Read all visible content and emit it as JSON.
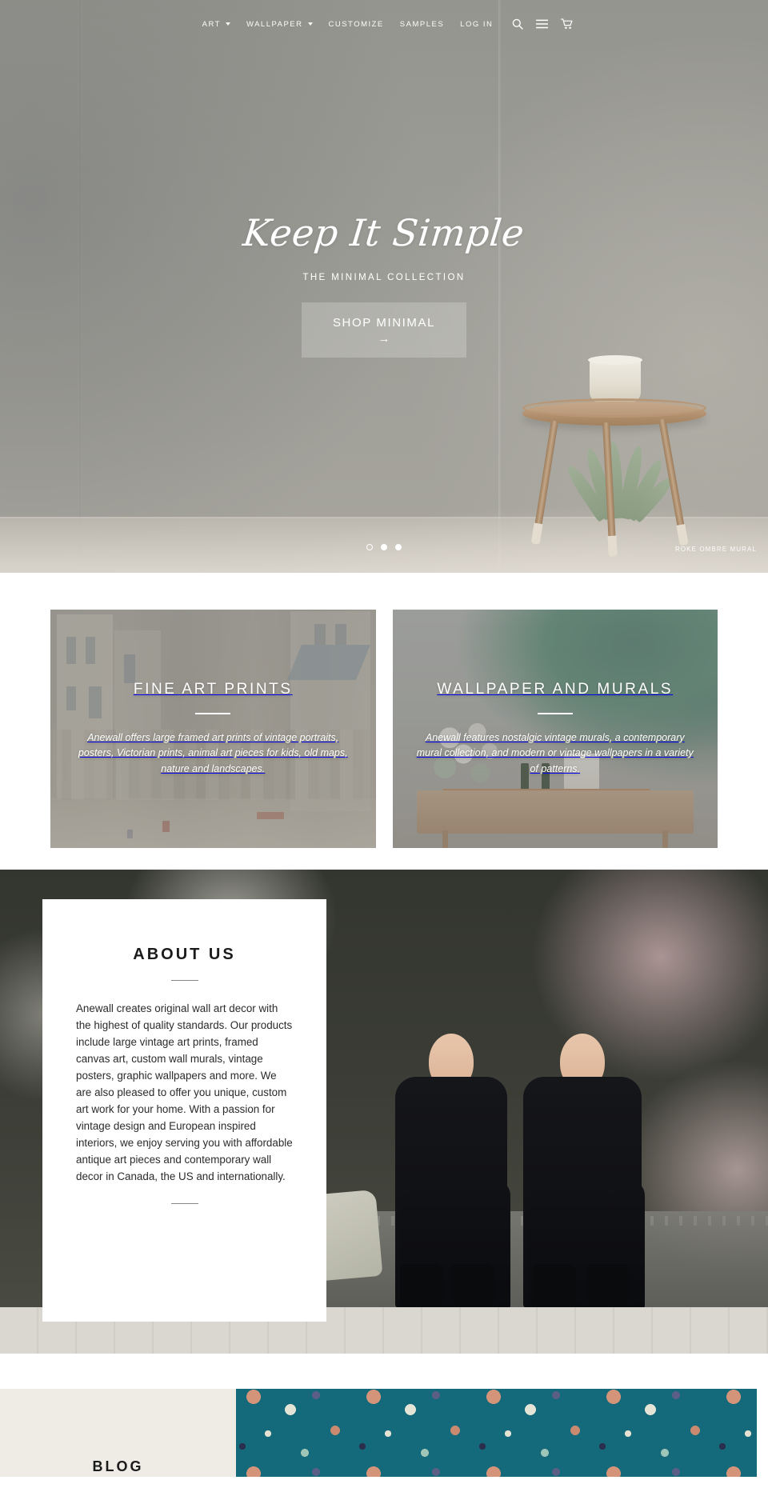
{
  "nav": {
    "items": [
      {
        "label": "ART",
        "has_caret": true
      },
      {
        "label": "WALLPAPER",
        "has_caret": true
      },
      {
        "label": "CUSTOMIZE",
        "has_caret": false
      },
      {
        "label": "SAMPLES",
        "has_caret": false
      },
      {
        "label": "LOG IN",
        "has_caret": false
      }
    ],
    "icons": [
      "search-icon",
      "menu-icon",
      "cart-icon"
    ]
  },
  "hero": {
    "script_title": "Keep It Simple",
    "subtitle": "THE MINIMAL COLLECTION",
    "button_label": "SHOP MINIMAL",
    "button_arrow": "→",
    "slide_caption": "ROKE OMBRE MURAL",
    "dots": [
      {
        "active": true
      },
      {
        "active": false
      },
      {
        "active": false
      }
    ]
  },
  "cards": [
    {
      "title": "FINE ART PRINTS",
      "text": "Anewall offers large framed art prints of vintage portraits, posters, Victorian prints, animal art pieces for kids, old maps, nature and landscapes."
    },
    {
      "title": "WALLPAPER AND MURALS",
      "text": "Anewall features nostalgic vintage murals, a contemporary mural collection, and modern or vintage wallpapers in a variety of patterns."
    }
  ],
  "about": {
    "title": "ABOUT US",
    "text": "Anewall creates original wall art decor with the highest of quality standards. Our products include large vintage art prints, framed canvas art, custom wall murals, vintage posters, graphic wallpapers and more. We are also pleased to offer you unique, custom art work for your home. With a passion for vintage design and European inspired interiors, we enjoy serving you with affordable antique art pieces and contemporary wall decor in Canada, the US and internationally."
  },
  "blog": {
    "title": "BLOG"
  },
  "colors": {
    "hero_overlay": "#9a9a97",
    "blog_panel": "#efece5",
    "blog_pattern": "#14697b",
    "text_dark": "#1b1b1b",
    "white": "#ffffff"
  }
}
